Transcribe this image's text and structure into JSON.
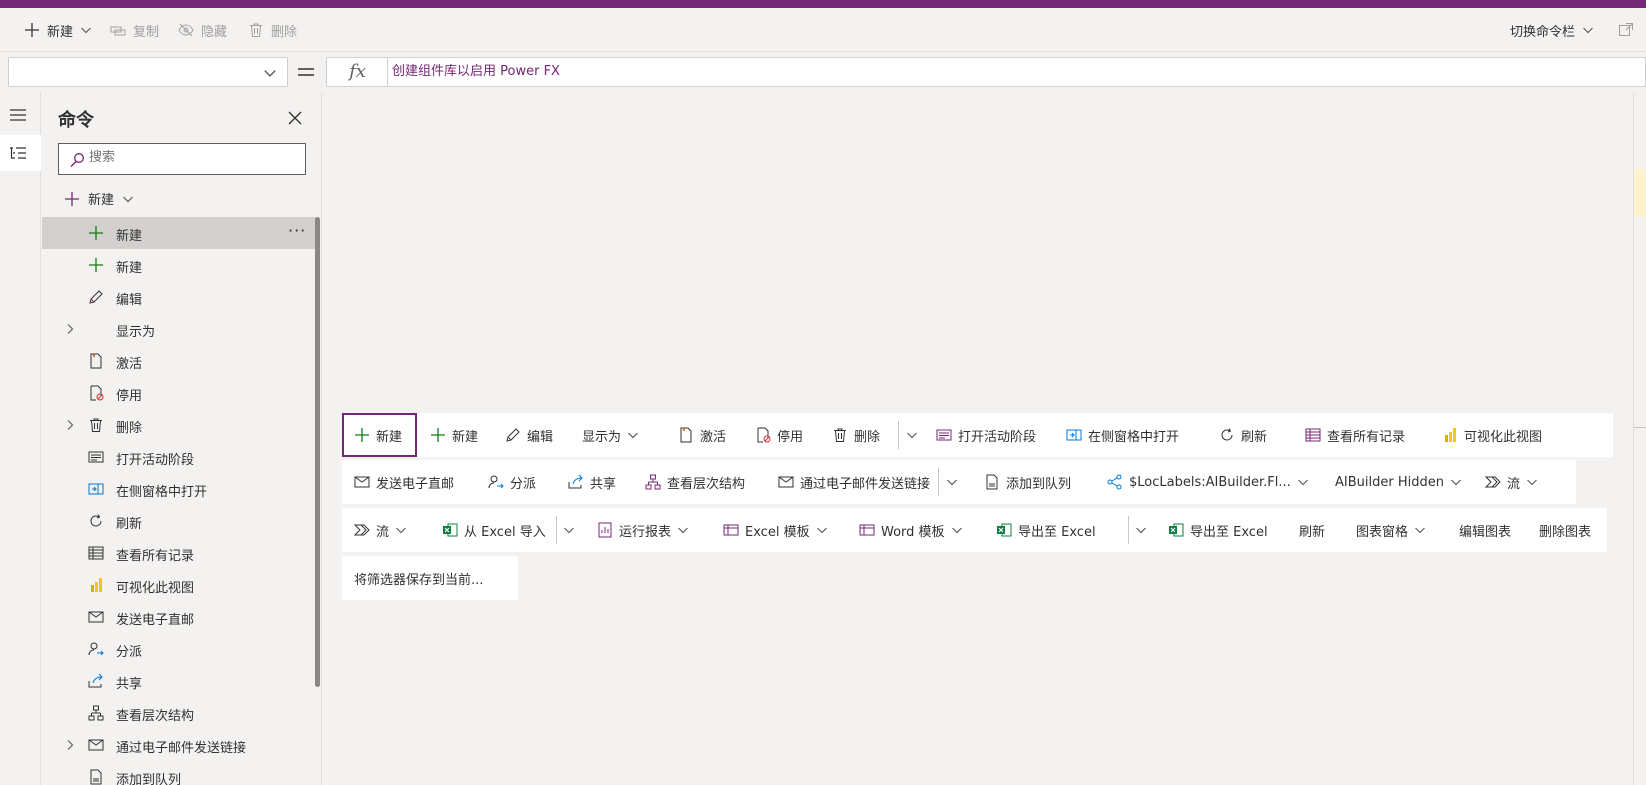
{
  "command_bar": {
    "new_label": "新建",
    "copy_label": "复制",
    "hide_label": "隐藏",
    "delete_label": "删除",
    "switch_label": "切换命令栏"
  },
  "formula_bar": {
    "property_value": "",
    "fx_label": "fx",
    "formula_text": "创建组件库以启用 Power FX"
  },
  "panel": {
    "title": "命令",
    "search_placeholder": "搜索",
    "group_label": "新建",
    "items": [
      {
        "label": "新建",
        "icon": "plus-icon",
        "expandable": false,
        "selected": true
      },
      {
        "label": "新建",
        "icon": "plus-icon",
        "expandable": false
      },
      {
        "label": "编辑",
        "icon": "pencil-icon",
        "expandable": false
      },
      {
        "label": "显示为",
        "icon": "",
        "expandable": true
      },
      {
        "label": "激活",
        "icon": "document-icon",
        "expandable": false
      },
      {
        "label": "停用",
        "icon": "document-blocked-icon",
        "expandable": false
      },
      {
        "label": "删除",
        "icon": "trash-icon",
        "expandable": true
      },
      {
        "label": "打开活动阶段",
        "icon": "stage-icon",
        "expandable": false
      },
      {
        "label": "在侧窗格中打开",
        "icon": "side-pane-icon",
        "expandable": false
      },
      {
        "label": "刷新",
        "icon": "refresh-icon",
        "expandable": false
      },
      {
        "label": "查看所有记录",
        "icon": "grid-icon",
        "expandable": false
      },
      {
        "label": "可视化此视图",
        "icon": "powerbi-icon",
        "expandable": false
      },
      {
        "label": "发送电子直邮",
        "icon": "mail-icon",
        "expandable": false
      },
      {
        "label": "分派",
        "icon": "person-assign-icon",
        "expandable": false
      },
      {
        "label": "共享",
        "icon": "share-icon",
        "expandable": false
      },
      {
        "label": "查看层次结构",
        "icon": "hierarchy-icon",
        "expandable": false
      },
      {
        "label": "通过电子邮件发送链接",
        "icon": "mail-link-icon",
        "expandable": true
      },
      {
        "label": "添加到队列",
        "icon": "queue-icon",
        "expandable": false
      }
    ]
  },
  "canvas_rows": {
    "row1": [
      {
        "label": "新建",
        "icon": "plus-icon"
      },
      {
        "label": "新建",
        "icon": "plus-icon"
      },
      {
        "label": "编辑",
        "icon": "pencil-icon"
      },
      {
        "label": "显示为",
        "icon": ""
      },
      {
        "label": "激活",
        "icon": "document-icon"
      },
      {
        "label": "停用",
        "icon": "document-blocked-icon"
      },
      {
        "label": "删除",
        "icon": "trash-icon"
      },
      {
        "label": "打开活动阶段",
        "icon": "stage-icon"
      },
      {
        "label": "在侧窗格中打开",
        "icon": "side-pane-icon"
      },
      {
        "label": "刷新",
        "icon": "refresh-icon"
      },
      {
        "label": "查看所有记录",
        "icon": "grid-icon"
      },
      {
        "label": "可视化此视图",
        "icon": "powerbi-icon"
      }
    ],
    "row2": [
      {
        "label": "发送电子直邮",
        "icon": "mail-icon"
      },
      {
        "label": "分派",
        "icon": "person-assign-icon"
      },
      {
        "label": "共享",
        "icon": "share-icon"
      },
      {
        "label": "查看层次结构",
        "icon": "hierarchy-icon"
      },
      {
        "label": "通过电子邮件发送链接",
        "icon": "mail-link-icon"
      },
      {
        "label": "添加到队列",
        "icon": "queue-icon"
      },
      {
        "label": "$LocLabels:AIBuilder.Fl...",
        "icon": "aibuilder-icon"
      },
      {
        "label": "AIBuilder Hidden",
        "icon": ""
      },
      {
        "label": "流",
        "icon": "flow-icon"
      }
    ],
    "row3": [
      {
        "label": "流",
        "icon": "flow-icon"
      },
      {
        "label": "从 Excel 导入",
        "icon": "excel-icon"
      },
      {
        "label": "运行报表",
        "icon": "report-icon"
      },
      {
        "label": "Excel 模板",
        "icon": "template-icon"
      },
      {
        "label": "Word 模板",
        "icon": "template-icon"
      },
      {
        "label": "导出至 Excel",
        "icon": "excel-icon"
      },
      {
        "label": "导出至 Excel",
        "icon": "excel-icon"
      },
      {
        "label": "刷新",
        "icon": ""
      },
      {
        "label": "图表窗格",
        "icon": ""
      },
      {
        "label": "编辑图表",
        "icon": ""
      },
      {
        "label": "删除图表",
        "icon": ""
      }
    ],
    "row4": [
      {
        "label": "将筛选器保存到当前...",
        "icon": ""
      }
    ]
  },
  "colors": {
    "brand": "#742774",
    "plus": "#107c10",
    "excel": "#107c41",
    "powerbi": "#f2c811",
    "accent_blue": "#0078d4"
  }
}
